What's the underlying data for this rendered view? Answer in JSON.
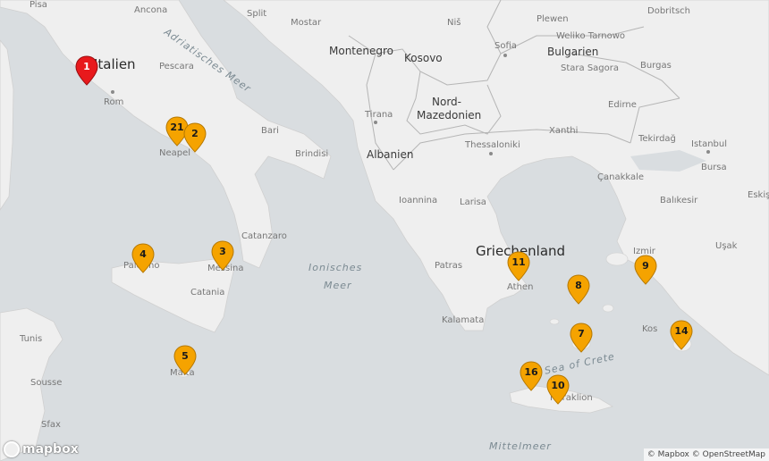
{
  "map": {
    "water_color": "#d9dde0",
    "land_color": "#efefef",
    "border_color": "#b5b5b5",
    "marker_color": "#f5a300",
    "marker_highlight_color": "#e8191c"
  },
  "labels": {
    "pisa": "Pisa",
    "ancona": "Ancona",
    "split": "Split",
    "mostar": "Mostar",
    "nis": "Niš",
    "plewen": "Plewen",
    "dobritsch": "Dobritsch",
    "adria": "Adriatisches Meer",
    "sofia": "Sofia",
    "weliko": "Weliko Tarnowo",
    "montenegro": "Montenegro",
    "kosovo": "Kosovo",
    "bulgarien": "Bulgarien",
    "italien": "Italien",
    "pescara": "Pescara",
    "burgas": "Burgas",
    "stara": "Stara Sagora",
    "rom": "Rom",
    "nord1": "Nord-",
    "nord2": "Mazedonien",
    "edirne": "Edirne",
    "tirana": "Tirana",
    "bari": "Bari",
    "xanthi": "Xanthi",
    "tekirdag": "Tekirdağ",
    "istanbul": "Istanbul",
    "neapel": "Neapel",
    "albanien": "Albanien",
    "thessaloniki": "Thessaloniki",
    "brindisi": "Brindisi",
    "bursa": "Bursa",
    "canakkale": "Çanakkale",
    "eskis": "Eskiş",
    "ioannina": "Ioannina",
    "larisa": "Larisa",
    "balikesir": "Balıkesir",
    "catanzaro": "Catanzaro",
    "griechenland": "Griechenland",
    "izmir": "Izmir",
    "usak": "Uşak",
    "palermo": "Palermo",
    "messina": "Messina",
    "ionisches1": "Ionisches",
    "ionisches2": "Meer",
    "patras": "Patras",
    "catania": "Catania",
    "athen": "Athen",
    "kalamata": "Kalamata",
    "tunis": "Tunis",
    "kos": "Kos",
    "malta": "Malta",
    "sousse": "Sousse",
    "crete": "Sea of Crete",
    "heraklion": "Heraklion",
    "sfax": "Sfax",
    "mittelmeer": "Mittelmeer"
  },
  "markers": [
    {
      "id": "1",
      "label": "1",
      "highlight": true
    },
    {
      "id": "21",
      "label": "21"
    },
    {
      "id": "2",
      "label": "2"
    },
    {
      "id": "4",
      "label": "4"
    },
    {
      "id": "3",
      "label": "3"
    },
    {
      "id": "5",
      "label": "5"
    },
    {
      "id": "11",
      "label": "11"
    },
    {
      "id": "8",
      "label": "8"
    },
    {
      "id": "9",
      "label": "9"
    },
    {
      "id": "7",
      "label": "7"
    },
    {
      "id": "14",
      "label": "14"
    },
    {
      "id": "16",
      "label": "16"
    },
    {
      "id": "10",
      "label": "10"
    }
  ],
  "attribution": "© Mapbox © OpenStreetMap",
  "logo_text": "mapbox"
}
